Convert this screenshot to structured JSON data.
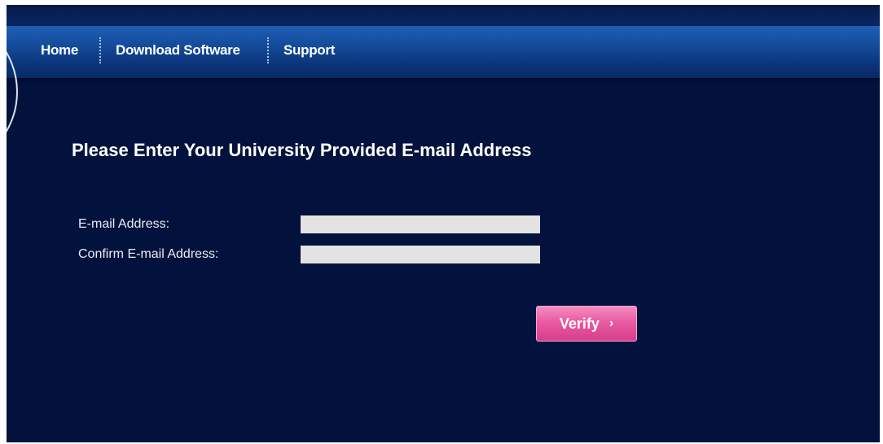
{
  "nav": {
    "items": [
      {
        "label": "Home"
      },
      {
        "label": "Download Software"
      },
      {
        "label": "Support"
      }
    ]
  },
  "form": {
    "title": "Please Enter Your University Provided E-mail Address",
    "email_label": "E-mail Address:",
    "email_value": "",
    "confirm_label": "Confirm E-mail Address:",
    "confirm_value": "",
    "verify_label": "Verify",
    "verify_icon": "chevron-right-icon"
  },
  "colors": {
    "background": "#03123d",
    "nav_blue": "#134a99",
    "button_pink": "#e95aa3",
    "field_gray": "#e3e3e3"
  }
}
